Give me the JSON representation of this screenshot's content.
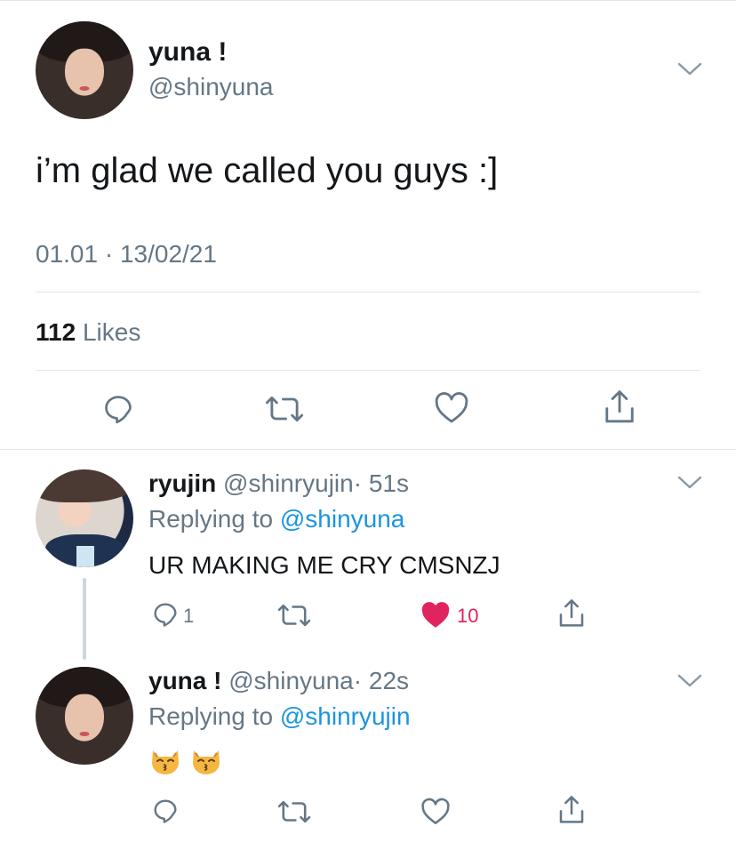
{
  "main_tweet": {
    "display_name": "yuna !",
    "handle": "@shinyuna",
    "text": "i’m glad we called you guys :]",
    "timestamp": "01.01 · 13/02/21",
    "likes_count": "112",
    "likes_label": "Likes"
  },
  "replies": [
    {
      "display_name": "ryujin",
      "handle": "@shinryujin",
      "time": "· 51s",
      "replying_prefix": "Replying to",
      "replying_to": "@shinyuna",
      "text": "UR MAKING ME CRY CMSNZJ",
      "reply_count": "1",
      "like_count": "10",
      "liked": true
    },
    {
      "display_name": "yuna !",
      "handle": "@shinyuna",
      "time": "· 22s",
      "replying_prefix": "Replying to",
      "replying_to": "@shinryujin",
      "text": "",
      "emojis": [
        "kissing-cat-emoji",
        "kissing-cat-emoji"
      ]
    }
  ],
  "colors": {
    "accent": "#1b95e0",
    "like": "#e0245e",
    "muted": "#657786",
    "divider": "#e1e8ed"
  },
  "icons": [
    "chevron-down-icon",
    "reply-icon",
    "retweet-icon",
    "like-icon",
    "share-icon"
  ]
}
